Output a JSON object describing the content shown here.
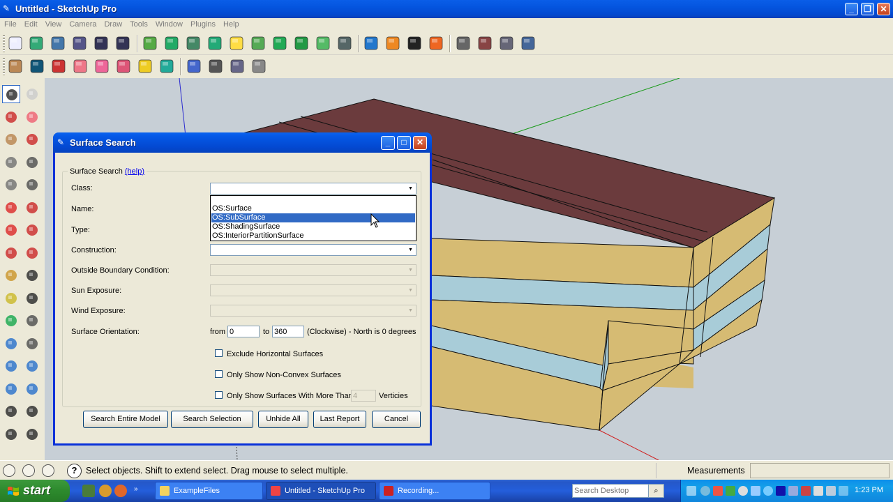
{
  "window": {
    "title": "Untitled - SketchUp Pro"
  },
  "menu": [
    "File",
    "Edit",
    "View",
    "Camera",
    "Draw",
    "Tools",
    "Window",
    "Plugins",
    "Help"
  ],
  "toolbar_icons": {
    "row1": [
      "new-space-icon",
      "import-icon",
      "save-icon",
      "save-as-icon",
      "export-idf-icon",
      "import-idf-icon",
      "new-space-type-icon",
      "new-thermal-zone-icon",
      "new-building-story-icon",
      "new-construction-icon",
      "new-light-icon",
      "new-schedule-icon",
      "set-attributes-icon",
      "surface-matching-icon",
      "plane-icon",
      "grid-icon",
      "inspector-icon",
      "surface-search-icon",
      "select-tool-icon",
      "warning-icon",
      "render-boundary-icon",
      "render-construction-icon",
      "render-layer-icon",
      "help-icon"
    ],
    "row2": [
      "box-icon",
      "box-dark-icon",
      "brick-wall-icon",
      "brick-pink-icon",
      "cube-pink-icon",
      "brick-stack-icon",
      "yellow-cube-icon",
      "droplet-icon",
      "wireframe-cube-icon",
      "hidden-line-icon",
      "shaded-icon",
      "calendar-icon"
    ]
  },
  "palette_icons": [
    "select-icon",
    "component-icon",
    "paint-bucket-icon",
    "eraser-icon",
    "rectangle-icon",
    "pencil-icon",
    "circle-icon",
    "arc-icon",
    "polygon-icon",
    "freehand-icon",
    "move-icon",
    "push-pull-icon",
    "rotate-icon",
    "follow-me-icon",
    "scale-icon",
    "offset-icon",
    "tape-measure-icon",
    "dimension-icon",
    "protractor-icon",
    "text-icon",
    "axes-icon",
    "3d-text-icon",
    "orbit-icon",
    "pan-icon",
    "zoom-icon",
    "zoom-window-icon",
    "zoom-extents-icon",
    "previous-view-icon",
    "position-camera-icon",
    "look-around-icon",
    "walk-icon",
    "section-plane-icon"
  ],
  "dialog": {
    "title": "Surface Search",
    "group_label": "Surface Search",
    "help_link": "(help)",
    "fields": {
      "class": "Class:",
      "name": "Name:",
      "type": "Type:",
      "construction": "Construction:",
      "outside_boundary": "Outside Boundary Condition:",
      "sun_exposure": "Sun Exposure:",
      "wind_exposure": "Wind Exposure:",
      "orientation": "Surface Orientation:"
    },
    "class_options": [
      "OS:Surface",
      "OS:SubSurface",
      "OS:ShadingSurface",
      "OS:InteriorPartitionSurface"
    ],
    "class_selected_index": 1,
    "orientation": {
      "from_label": "from",
      "from_value": "0",
      "to_label": "to",
      "to_value": "360",
      "suffix": "(Clockwise) - North is 0 degrees"
    },
    "checkboxes": {
      "exclude_horizontal": "Exclude Horizontal Surfaces",
      "non_convex": "Only Show Non-Convex Surfaces",
      "more_than": "Only Show Surfaces With More Than",
      "more_than_value": "4",
      "verticies": "Verticies"
    },
    "buttons": {
      "search_entire": "Search Entire Model",
      "search_selection": "Search Selection",
      "unhide_all": "Unhide All",
      "last_report": "Last Report",
      "cancel": "Cancel"
    }
  },
  "status": {
    "message": "Select objects. Shift to extend select. Drag mouse to select multiple.",
    "measurements_label": "Measurements"
  },
  "taskbar": {
    "start": "start",
    "tasks": [
      "ExampleFiles",
      "Untitled - SketchUp Pro",
      "Recording..."
    ],
    "search_placeholder": "Search Desktop",
    "clock": "1:23 PM"
  },
  "colors": {
    "roof": "#6b3b3d",
    "wall_tan": "#d6bb73",
    "glazing": "#a8ccd8",
    "viewport_bg": "#c7cfd6",
    "xp_blue": "#0a5ee8",
    "selection": "#316ac5"
  }
}
